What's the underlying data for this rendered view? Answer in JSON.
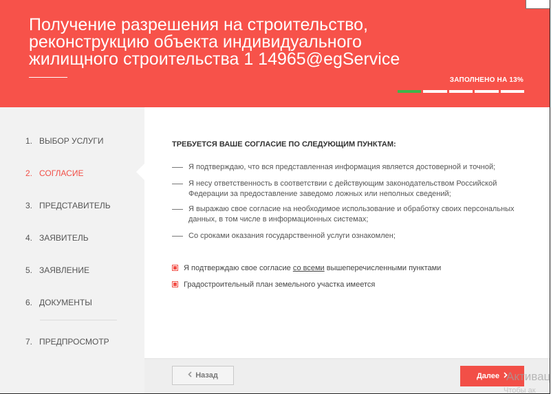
{
  "header": {
    "title_line1": "Получение разрешения на строительство,",
    "title_line2": "реконструкцию объекта индивидуального",
    "title_line3": "жилищного строительства 1 14965@egService",
    "progress_label": "ЗАПОЛНЕНО НА 13%",
    "progress_segments_total": 5,
    "progress_segments_done": 1
  },
  "sidebar": {
    "steps": [
      {
        "num": "1.",
        "label": "ВЫБОР УСЛУГИ",
        "active": false
      },
      {
        "num": "2.",
        "label": "СОГЛАСИЕ",
        "active": true
      },
      {
        "num": "3.",
        "label": "ПРЕДСТАВИТЕЛЬ",
        "active": false
      },
      {
        "num": "4.",
        "label": "ЗАЯВИТЕЛЬ",
        "active": false
      },
      {
        "num": "5.",
        "label": "ЗАЯВЛЕНИЕ",
        "active": false
      },
      {
        "num": "6.",
        "label": "ДОКУМЕНТЫ",
        "active": false
      },
      {
        "num": "7.",
        "label": "ПРЕДПРОСМОТР",
        "active": false
      }
    ]
  },
  "content": {
    "heading": "ТРЕБУЕТСЯ ВАШЕ СОГЛАСИЕ ПО СЛЕДУЮЩИМ ПУНКТАМ:",
    "agreements": [
      "Я подтверждаю, что вся представленная информация является достоверной и точной;",
      "Я несу ответственность в соответствии с действующим законодательством Российской Федерации за предоставление заведомо ложных или неполных сведений;",
      "Я выражаю свое согласие на необходимое использование и обработку своих персональных данных, в том числе в информационных системах;",
      "Со сроками оказания государственной услуги ознакомлен;"
    ],
    "checkboxes": {
      "consent_before": "Я подтверждаю свое согласие ",
      "consent_link": "со всеми",
      "consent_after": " вышеперечисленными пунктами",
      "consent_checked": true,
      "plan_label": "Градостроительный план земельного участка имеется",
      "plan_checked": true
    }
  },
  "footer": {
    "back_label": "Назад",
    "next_label": "Далее",
    "watermark": "Активац",
    "watermark2": "Чтобы ак"
  },
  "colors": {
    "brand_red": "#f7524a",
    "accent_red": "#f24f47",
    "progress_green": "#3cb54a"
  }
}
